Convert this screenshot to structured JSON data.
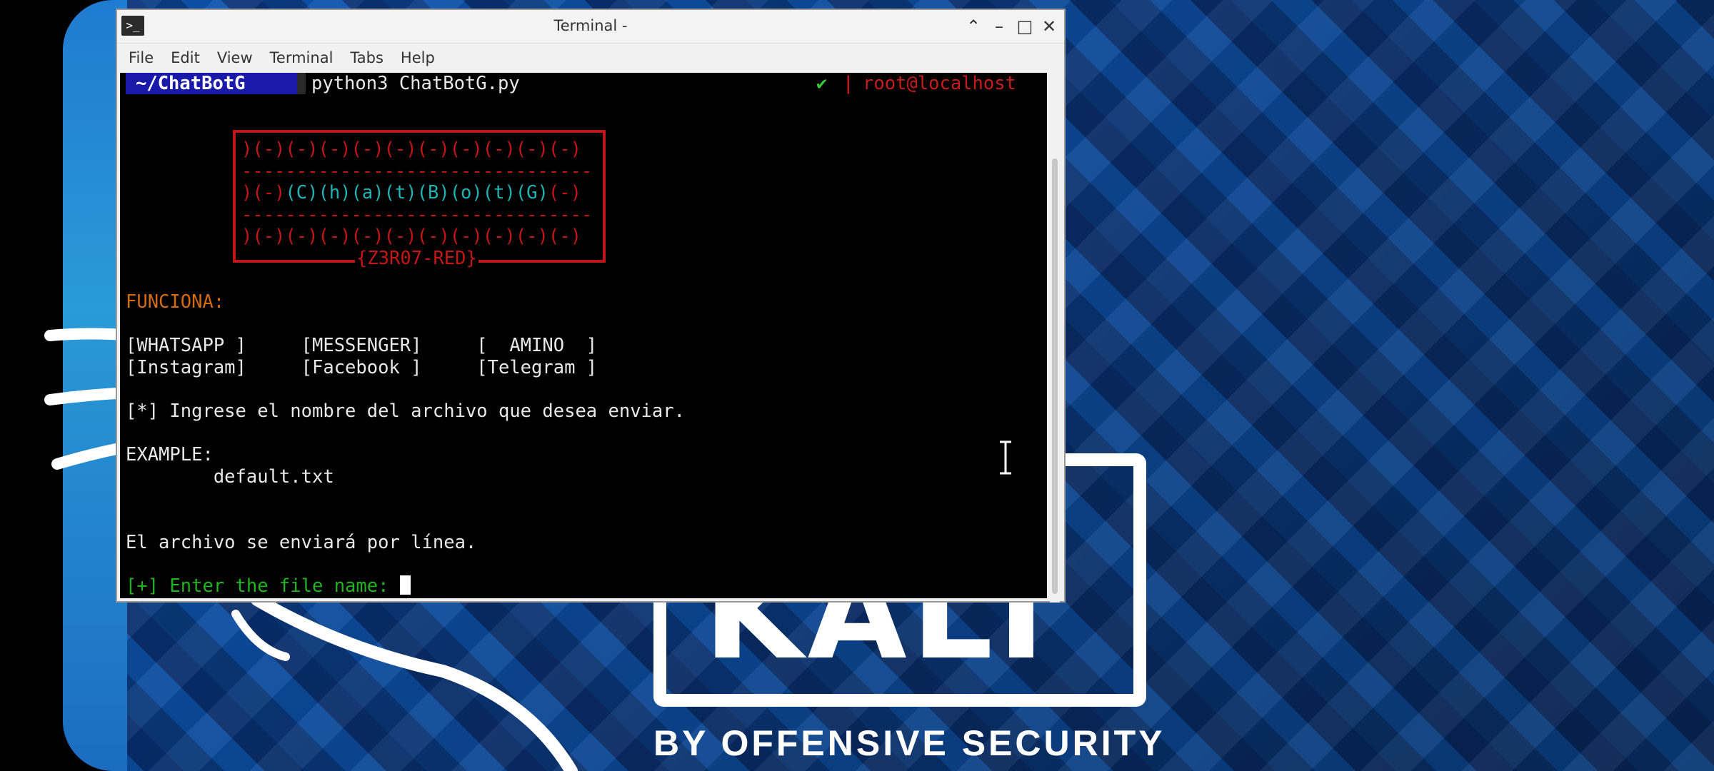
{
  "window": {
    "title": "Terminal -",
    "app_icon": "terminal-icon",
    "controls": [
      "chevron-up-icon",
      "minimize-icon",
      "maximize-icon",
      "close-icon"
    ]
  },
  "menu": [
    "File",
    "Edit",
    "View",
    "Terminal",
    "Tabs",
    "Help"
  ],
  "prompt": {
    "path": "~/ChatBotG",
    "command": "python3 ChatBotG.py",
    "status_icon": "check-icon",
    "status_glyph": "✔",
    "separator": "|",
    "user_host": "root@localhost"
  },
  "banner": {
    "row1": ")(-)(-)(-)(-)(-)(-)(-)(-)(-)(-)",
    "rule": "--------------------------------",
    "row2_prefix": ")(-)",
    "row2_letters": "(C)(h)(a)(t)(B)(o)(t)(G)",
    "row2_suffix": "(-)",
    "row3": ")(-)(-)(-)(-)(-)(-)(-)(-)(-)(-)",
    "signature": "{Z3R07-RED}"
  },
  "output": {
    "funciona_label": "FUNCIONA:",
    "platforms_row1": "[WHATSAPP ]     [MESSENGER]     [  AMINO  ]",
    "platforms_row2": "[Instagram]     [Facebook ]     [Telegram ]",
    "instruction": "[*] Ingrese el nombre del archivo que desea enviar.",
    "example_label": "EXAMPLE:",
    "example_value": "        default.txt",
    "note": "El archivo se enviará por línea.",
    "input_prompt": "[+] Enter the file name: "
  },
  "wallpaper": {
    "brand": "KALI",
    "tagline": "BY OFFENSIVE SECURITY"
  },
  "colors": {
    "prompt_bg": "#1a1aa8",
    "banner_red": "#c51616",
    "banner_cyan": "#1fb3b3",
    "label_orange": "#d46a12",
    "input_green": "#21b321"
  }
}
